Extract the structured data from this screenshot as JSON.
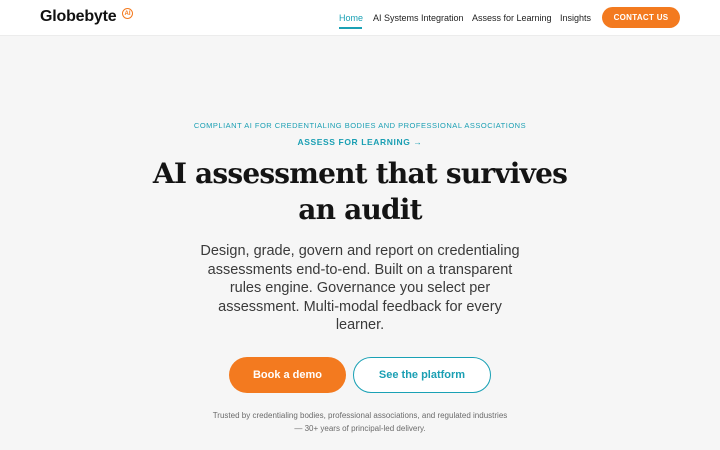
{
  "header": {
    "logo_text": "Globebyte",
    "logo_badge": "AI",
    "nav": {
      "home": "Home",
      "ai_systems": "AI Systems Integration",
      "assess": "Assess for Learning",
      "insights": "Insights"
    },
    "contact_label": "CONTACT US"
  },
  "hero": {
    "eyebrow": "COMPLIANT AI FOR CREDENTIALING BODIES AND PROFESSIONAL ASSOCIATIONS",
    "assess_link": "ASSESS FOR LEARNING →",
    "headline": "AI assessment that survives an audit",
    "subtext": "Design, grade, govern and report on credentialing assessments end-to-end. Built on a transparent rules engine. Governance you select per assessment. Multi-modal feedback for every learner.",
    "primary_cta": "Book a demo",
    "secondary_cta": "See the platform",
    "trust_text": "Trusted by credentialing bodies, professional associations, and regulated industries — 30+ years of principal-led delivery."
  },
  "colors": {
    "accent_orange": "#f37a1f",
    "accent_teal": "#1aa1b5"
  }
}
